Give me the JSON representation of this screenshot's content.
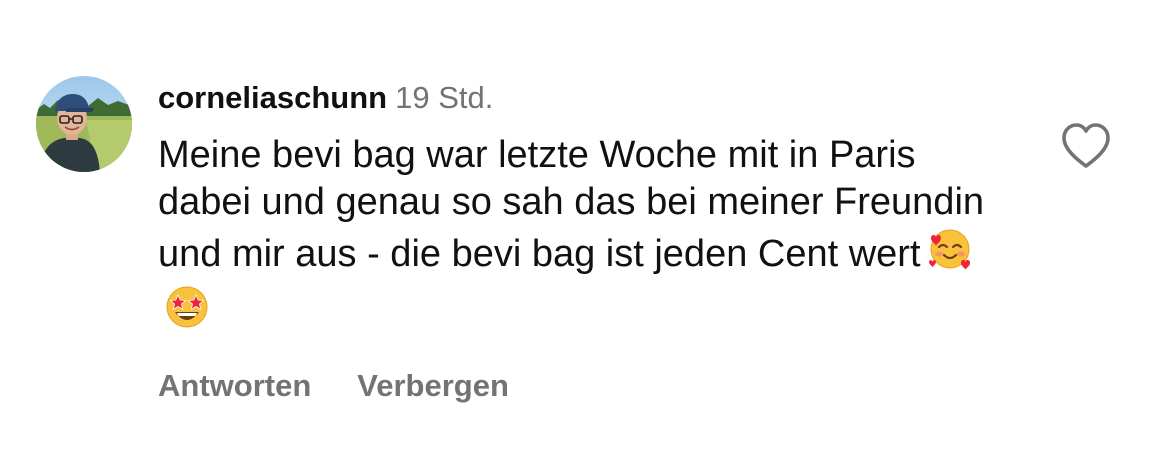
{
  "comment": {
    "username": "corneliaschunn",
    "timestamp": "19 Std.",
    "text": "Meine bevi bag war letzte Woche mit in Paris dabei und genau so sah das bei meiner Freundin und mir aus - die bevi bag ist jeden Cent wert",
    "emojis": [
      "smiling-face-with-hearts-emoji",
      "star-struck-emoji"
    ],
    "actions": {
      "reply_label": "Antworten",
      "hide_label": "Verbergen"
    },
    "like_icon": "heart-outline-icon"
  },
  "colors": {
    "text": "#111111",
    "secondary_text": "#737373",
    "background": "#ffffff"
  }
}
